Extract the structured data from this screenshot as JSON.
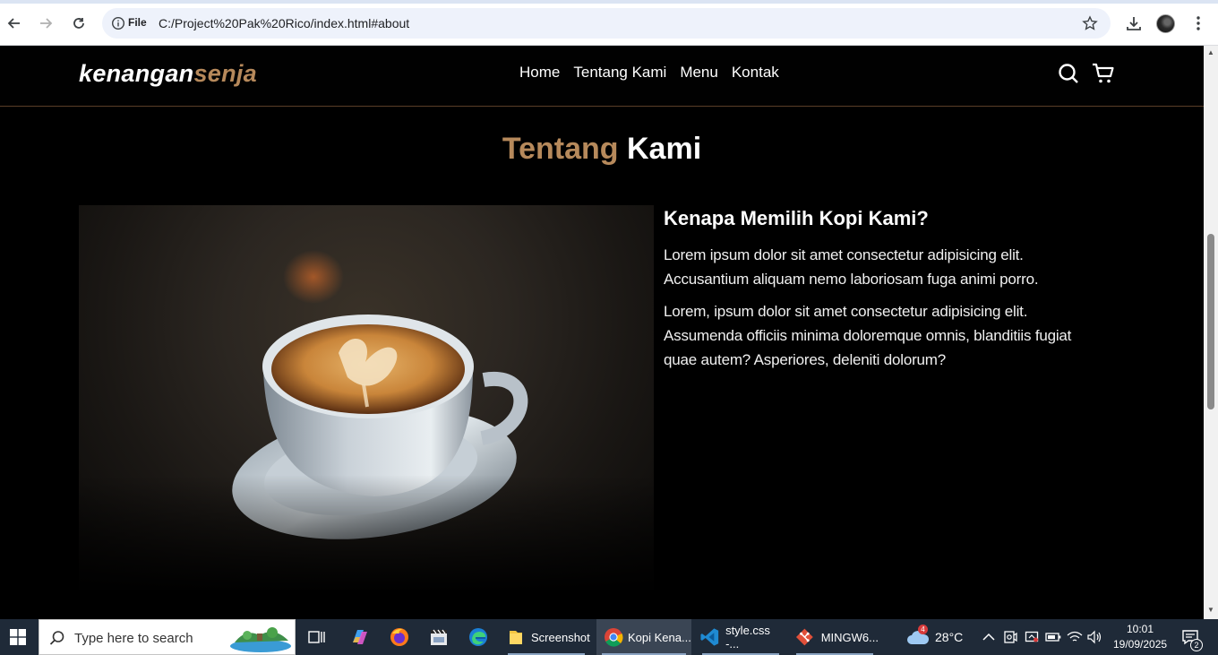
{
  "browser": {
    "omnibox_label": "File",
    "url": "C:/Project%20Pak%20Rico/index.html#about"
  },
  "site": {
    "logo_main": "kenangan",
    "logo_accent": "senja",
    "nav": [
      "Home",
      "Tentang Kami",
      "Menu",
      "Kontak"
    ]
  },
  "about": {
    "title_accent": "Tentang",
    "title_main": "Kami",
    "heading": "Kenapa Memilih Kopi Kami?",
    "paragraphs": [
      "Lorem ipsum dolor sit amet consectetur adipisicing elit. Accusantium aliquam nemo laboriosam fuga animi porro.",
      "Lorem, ipsum dolor sit amet consectetur adipisicing elit. Assumenda officiis minima doloremque omnis, blanditiis fugiat quae autem? Asperiores, deleniti dolorum?"
    ]
  },
  "taskbar": {
    "search_placeholder": "Type here to search",
    "apps": [
      {
        "label": "Screenshot"
      },
      {
        "label": "Kopi Kena..."
      },
      {
        "label": "style.css -..."
      },
      {
        "label": "MINGW6..."
      }
    ],
    "weather_badge": "4",
    "weather_temp": "28°C",
    "time": "10:01",
    "date": "19/09/2025",
    "notification_count": "2"
  },
  "colors": {
    "accent": "#b6895b",
    "background": "#000000",
    "taskbar": "#1f2a38"
  }
}
